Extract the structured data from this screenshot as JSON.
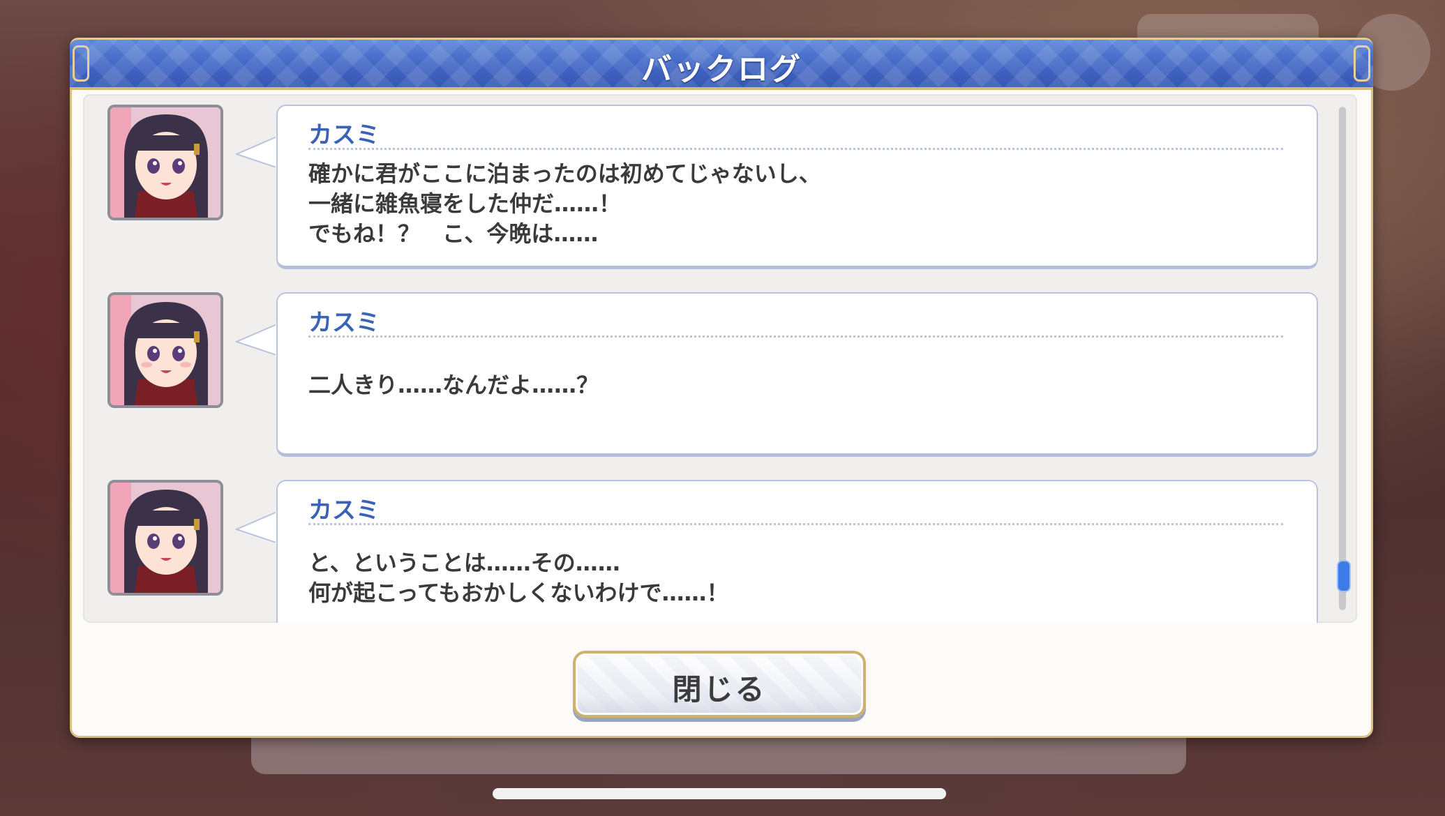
{
  "dialog": {
    "title": "バックログ",
    "close_label": "閉じる"
  },
  "entries": [
    {
      "speaker": "カスミ",
      "lines": [
        "確かに君がここに泊まったのは初めてじゃないし、",
        "一緒に雑魚寝をした仲だ……！",
        "でもね！？　こ、今晩は……"
      ]
    },
    {
      "speaker": "カスミ",
      "lines": [
        "二人きり……なんだよ……？"
      ]
    },
    {
      "speaker": "カスミ",
      "lines": [
        "と、ということは……その……",
        "何が起こってもおかしくないわけで……！"
      ]
    }
  ],
  "scroll": {
    "position": 0.95
  },
  "colors": {
    "header_blue": "#4a70cc",
    "gold_border": "#d9bf86",
    "speaker_blue": "#3a63b5",
    "scroll_thumb": "#3d7be6"
  }
}
